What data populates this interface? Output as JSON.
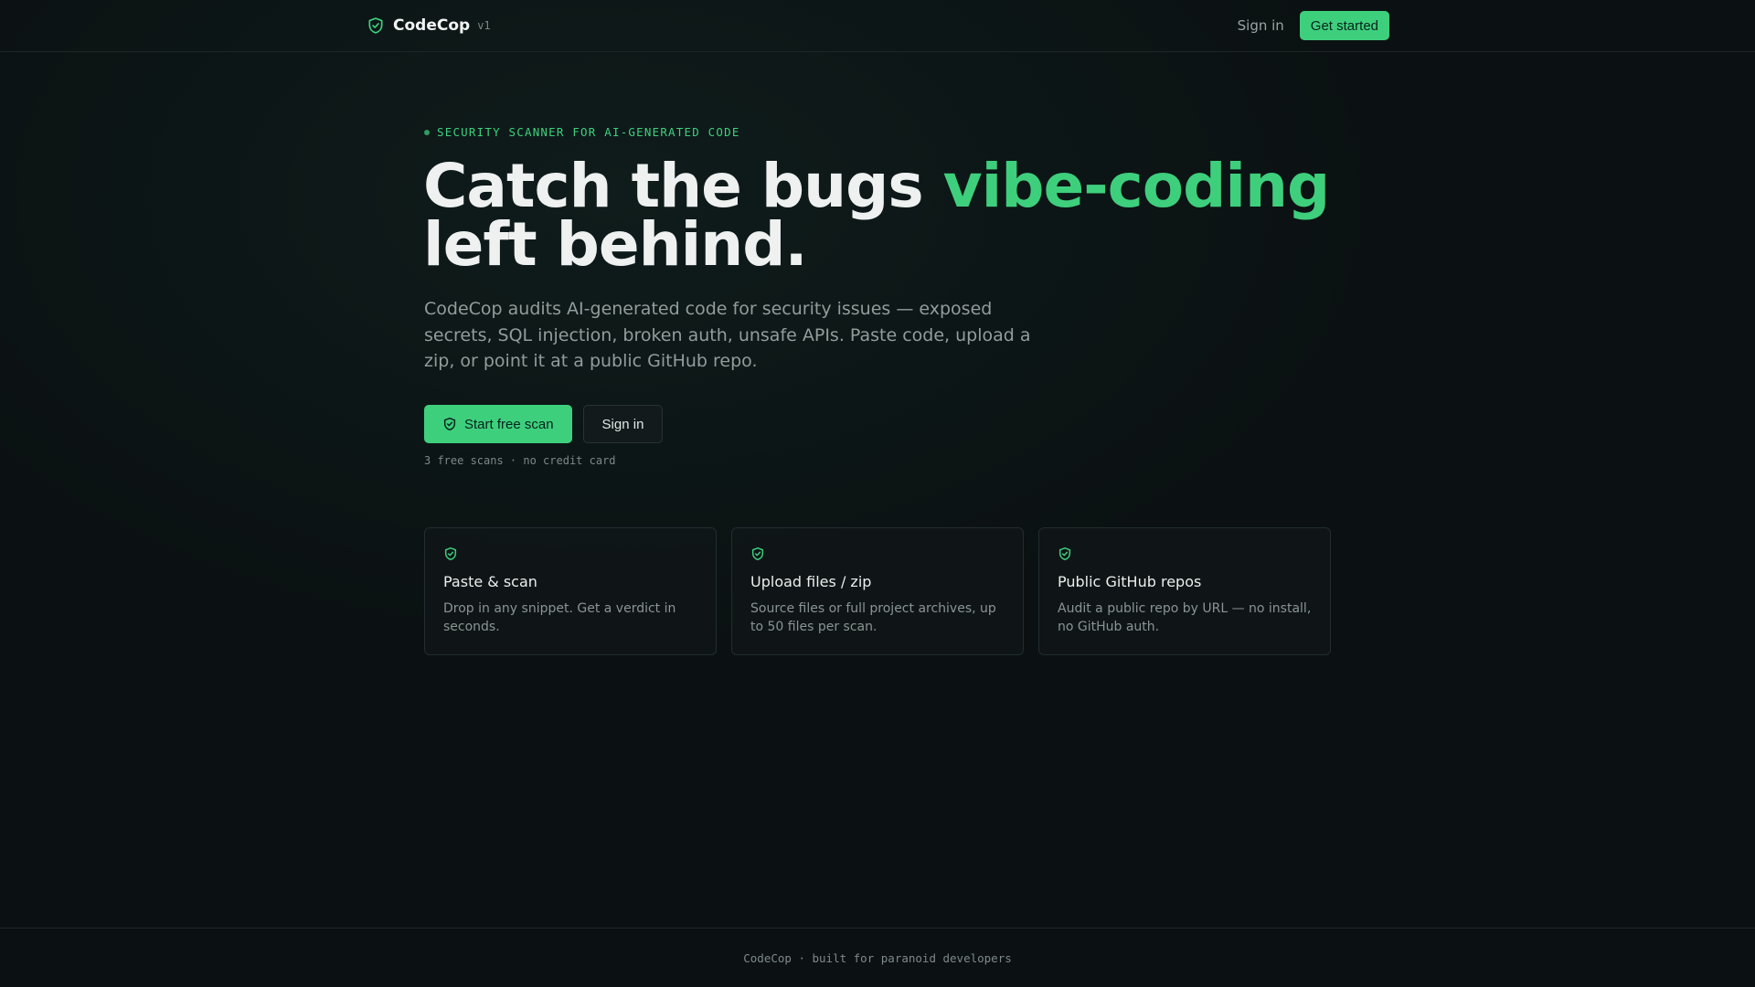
{
  "header": {
    "brand": "CodeCop",
    "version": "v1",
    "signin_label": "Sign in",
    "cta_label": "Get started"
  },
  "hero": {
    "eyebrow": "SECURITY SCANNER FOR AI-GENERATED CODE",
    "headline_part1": "Catch the bugs ",
    "headline_accent": "vibe-coding",
    "headline_part2": "left behind.",
    "lead": "CodeCop audits AI-generated code for security issues — exposed secrets, SQL injection, broken auth, unsafe APIs. Paste code, upload a zip, or point it at a public GitHub repo.",
    "primary_button": "Start free scan",
    "secondary_button": "Sign in",
    "fineprint": "3 free scans · no credit card"
  },
  "features": [
    {
      "title": "Paste & scan",
      "description": "Drop in any snippet. Get a verdict in seconds.",
      "icon": "shield-check-icon"
    },
    {
      "title": "Upload files / zip",
      "description": "Source files or full project archives, up to 50 files per scan.",
      "icon": "shield-check-icon"
    },
    {
      "title": "Public GitHub repos",
      "description": "Audit a public repo by URL — no install, no GitHub auth.",
      "icon": "shield-check-icon"
    }
  ],
  "footer": {
    "text": "CodeCop · built for paranoid developers"
  },
  "colors": {
    "background": "#0b1112",
    "accent": "#3ecf7d",
    "text": "#eef1f0",
    "muted": "#939c9b"
  }
}
